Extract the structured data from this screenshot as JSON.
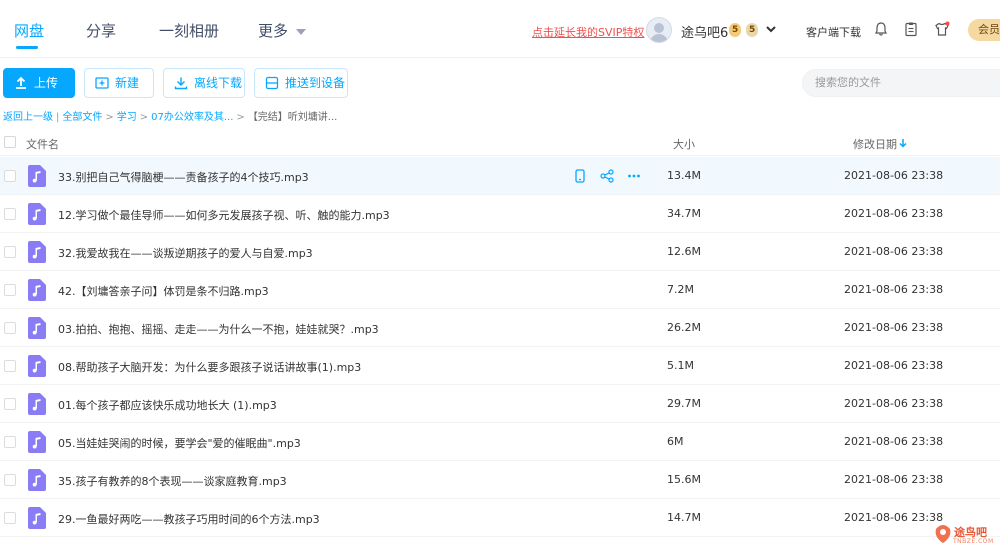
{
  "nav": {
    "tabs": [
      {
        "label": "网盘",
        "active": true
      },
      {
        "label": "分享",
        "active": false
      },
      {
        "label": "一刻相册",
        "active": false
      },
      {
        "label": "更多",
        "active": false
      }
    ],
    "svip_link": "点击延长我的SVIP特权",
    "username": "途乌吧6",
    "level_badge_1": "5",
    "level_badge_2": "5",
    "client_download": "客户端下载",
    "member_button": "会员"
  },
  "toolbar": {
    "upload": "上传",
    "new_folder": "新建",
    "offline_download": "离线下载",
    "push_to_device": "推送到设备",
    "search_placeholder": "搜索您的文件"
  },
  "breadcrumb": {
    "back": "返回上一级",
    "all_files": "全部文件",
    "level1": "学习",
    "level2": "07办公效率及其...",
    "current": "【完结】听刘墉讲..."
  },
  "table": {
    "col_name": "文件名",
    "col_size": "大小",
    "col_date": "修改日期",
    "rows": [
      {
        "name": "33.别把自己气得脑梗——责备孩子的4个技巧.mp3",
        "size": "13.4M",
        "date": "2021-08-06 23:38"
      },
      {
        "name": "12.学习做个最佳导师——如何多元发展孩子视、听、触的能力.mp3",
        "size": "34.7M",
        "date": "2021-08-06 23:38"
      },
      {
        "name": "32.我爱故我在——谈叛逆期孩子的爱人与自爱.mp3",
        "size": "12.6M",
        "date": "2021-08-06 23:38"
      },
      {
        "name": "42.【刘墉答亲子问】体罚是条不归路.mp3",
        "size": "7.2M",
        "date": "2021-08-06 23:38"
      },
      {
        "name": "03.拍拍、抱抱、摇摇、走走——为什么一不抱，娃娃就哭？.mp3",
        "size": "26.2M",
        "date": "2021-08-06 23:38"
      },
      {
        "name": "08.帮助孩子大脑开发：为什么要多跟孩子说话讲故事(1).mp3",
        "size": "5.1M",
        "date": "2021-08-06 23:38"
      },
      {
        "name": "01.每个孩子都应该快乐成功地长大 (1).mp3",
        "size": "29.7M",
        "date": "2021-08-06 23:38"
      },
      {
        "name": "05.当娃娃哭闹的时候，要学会\"爱的催眠曲\".mp3",
        "size": "6M",
        "date": "2021-08-06 23:38"
      },
      {
        "name": "35.孩子有教养的8个表现——谈家庭教育.mp3",
        "size": "15.6M",
        "date": "2021-08-06 23:38"
      },
      {
        "name": "29.一鱼最好两吃——教孩子巧用时间的6个方法.mp3",
        "size": "14.7M",
        "date": "2021-08-06 23:38"
      }
    ]
  },
  "watermark": {
    "text": "途鸟吧",
    "sub": "TNBZE.COM"
  },
  "colors": {
    "accent": "#06a7ff",
    "file_icon": "#8a7cf5",
    "svip_red": "#f04f4f"
  }
}
